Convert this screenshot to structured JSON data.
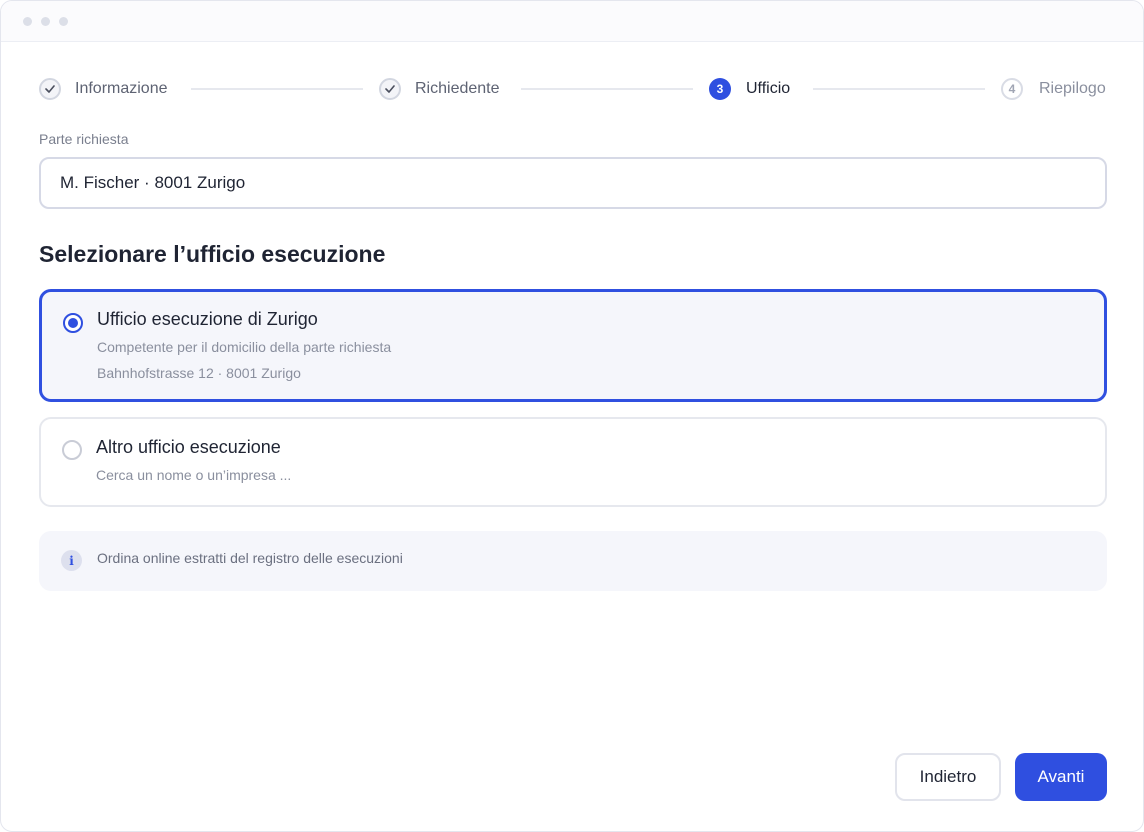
{
  "window": {
    "controls": [
      "dot",
      "dot",
      "dot"
    ]
  },
  "stepper": {
    "steps": [
      {
        "label": "Informazione",
        "state": "done",
        "icon": "check-icon"
      },
      {
        "label": "Richiedente",
        "state": "done",
        "icon": "check-icon"
      },
      {
        "label": "Ufficio",
        "state": "active",
        "number": "3"
      },
      {
        "label": "Riepilogo",
        "state": "future",
        "number": "4"
      }
    ]
  },
  "form": {
    "field_label": "Parte richiesta",
    "field_value": "M. Fischer · 8001 Zurigo",
    "section_title": "Selezionare l’ufficio esecuzione",
    "options": [
      {
        "title": "Ufficio esecuzione di Zurigo",
        "subtitle": "Competente per il domicilio della parte richiesta",
        "address": "Bahnhofstrasse 12 · 8001 Zurigo",
        "selected": true
      },
      {
        "title": "Altro ufficio esecuzione",
        "subtitle": "Cerca un nome o un’impresa ...",
        "selected": false
      }
    ],
    "info_icon": "i",
    "info_text": "Ordina online estratti del registro delle esecuzioni"
  },
  "buttons": {
    "back": "Indietro",
    "next": "Avanti"
  },
  "colors": {
    "accent": "#2f4fe0",
    "border": "#d6d9e6",
    "panel": "#f5f6fb"
  }
}
